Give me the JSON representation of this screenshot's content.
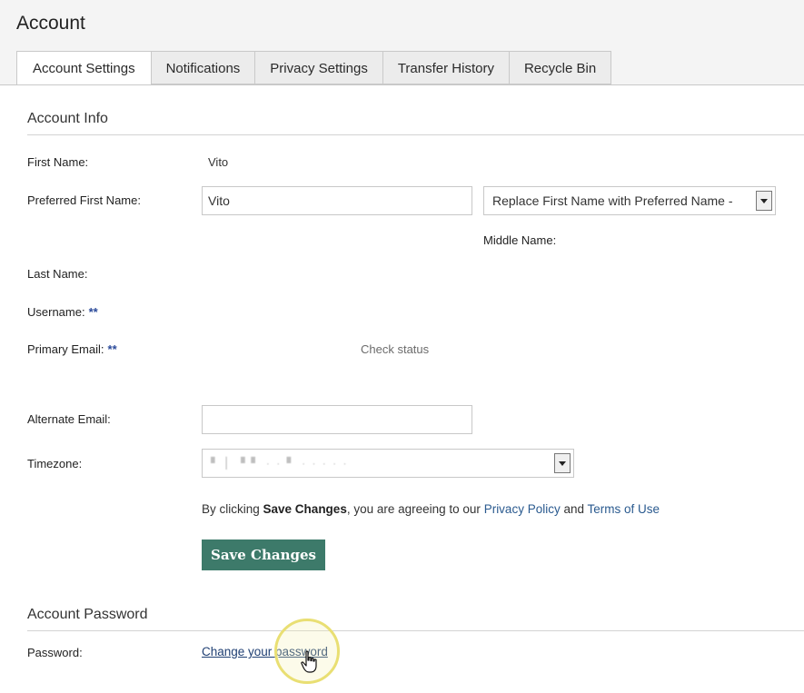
{
  "page": {
    "title": "Account"
  },
  "tabs": [
    {
      "label": "Account Settings",
      "active": true
    },
    {
      "label": "Notifications",
      "active": false
    },
    {
      "label": "Privacy Settings",
      "active": false
    },
    {
      "label": "Transfer History",
      "active": false
    },
    {
      "label": "Recycle Bin",
      "active": false
    }
  ],
  "account_info": {
    "title": "Account Info",
    "first_name": {
      "label": "First Name:",
      "value": "Vito"
    },
    "preferred_first_name": {
      "label": "Preferred First Name:",
      "value": "Vito",
      "option": "Replace First Name with Preferred Name -"
    },
    "middle_name": {
      "label": "Middle Name:"
    },
    "last_name": {
      "label": "Last Name:"
    },
    "username": {
      "label": "Username:",
      "required_mark": "**"
    },
    "primary_email": {
      "label": "Primary Email:",
      "required_mark": "**",
      "status_link": "Check status"
    },
    "alternate_email": {
      "label": "Alternate Email:",
      "value": ""
    },
    "timezone": {
      "label": "Timezone:",
      "value": "▘ ▏ ▘▘  ·  ·  ▘  ·  ·  ·  ·  ·"
    },
    "agreement": {
      "prefix": "By clicking ",
      "bold": "Save Changes",
      "middle": ", you are agreeing to our ",
      "privacy_link": "Privacy Policy",
      "and": " and ",
      "terms_link": "Terms of Use"
    },
    "save_label": "Save Changes"
  },
  "account_password": {
    "title": "Account Password",
    "password": {
      "label": "Password:",
      "link": "Change your password"
    }
  },
  "colors": {
    "accent_button": "#3d7a6a",
    "link": "#2a5a8f",
    "required": "#2b4a9a"
  }
}
